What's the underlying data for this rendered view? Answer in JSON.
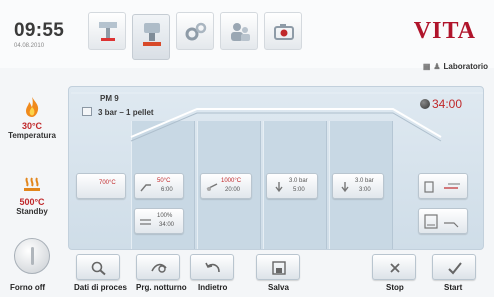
{
  "header": {
    "time": "09:55",
    "date": "04.08.2010",
    "logo": "VITA",
    "user_label": "Laboratorio"
  },
  "nav_tabs": [
    {
      "icon": "furnace-lift-icon"
    },
    {
      "icon": "program-furnace-icon",
      "active": true
    },
    {
      "icon": "settings-gears-icon"
    },
    {
      "icon": "users-icon"
    },
    {
      "icon": "camera-icon"
    }
  ],
  "status": {
    "temperature": {
      "value": "30°C",
      "label": "Temperatura",
      "icon": "flame-icon"
    },
    "standby": {
      "value": "500°C",
      "label": "Standby",
      "icon": "heat-waves-icon"
    },
    "furnace": {
      "label": "Forno off",
      "icon": "power-knob-icon"
    }
  },
  "program": {
    "name": "PM 9",
    "subtitle": "3 bar – 1 pellet",
    "remaining_time": "34:00"
  },
  "steps": {
    "start_temp": {
      "value": "700°C"
    },
    "pre_dry": {
      "line1": "50°C",
      "line2": "6:00",
      "icon": "rise-arrow-icon"
    },
    "heat": {
      "line1": "1000°C",
      "line2": "20:00",
      "icon": "heat-rise-icon"
    },
    "press1": {
      "line1": "3.0 bar",
      "line2": "5:00",
      "icon": "press-down-icon"
    },
    "press2": {
      "line1": "3.0 bar",
      "line2": "3:00",
      "icon": "press-down-icon"
    },
    "cooling": {
      "line1": "100%",
      "line2": "34:00",
      "icon": "cooling-icon"
    },
    "end_option_1": {
      "icon": "pressure-release-icon"
    },
    "end_option_2": {
      "icon": "chart-end-icon"
    }
  },
  "toolbar": {
    "process_data": {
      "label": "Dati di proces",
      "icon": "magnifier-icon"
    },
    "night_program": {
      "label": "Prg. notturno",
      "icon": "night-program-icon"
    },
    "back": {
      "label": "Indietro",
      "icon": "back-arrow-icon"
    },
    "save": {
      "label": "Salva",
      "icon": "save-icon"
    },
    "stop": {
      "label": "Stop",
      "icon": "close-icon"
    },
    "start": {
      "label": "Start",
      "icon": "check-icon"
    }
  },
  "colors": {
    "accent_red": "#c0282a",
    "logo_red": "#b0142b",
    "panel_blue": "#cfdde8"
  }
}
